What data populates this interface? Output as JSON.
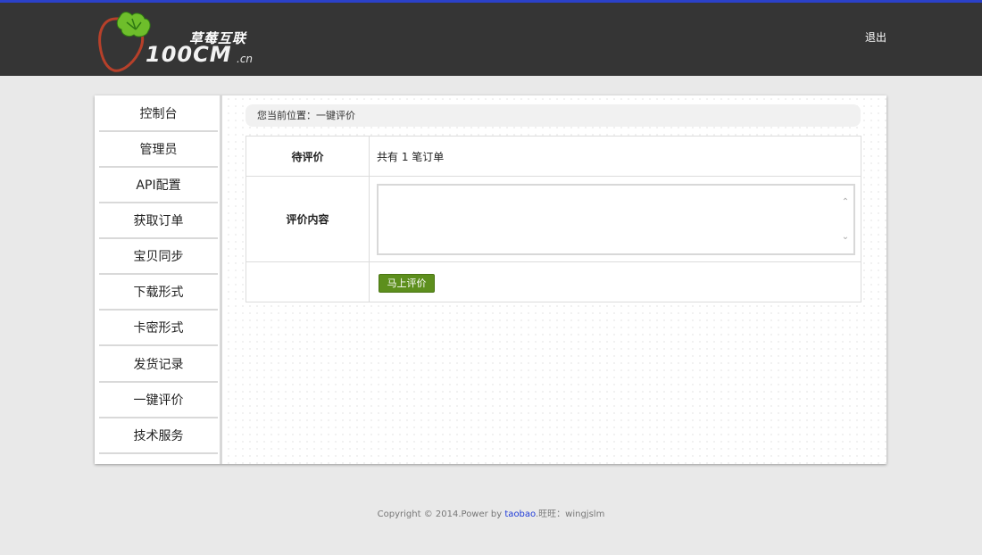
{
  "header": {
    "logo_cn": "草莓互联",
    "logo_main": "100CM",
    "logo_suffix": ".cn",
    "logout_label": "退出"
  },
  "sidebar": {
    "items": [
      {
        "label": "控制台"
      },
      {
        "label": "管理员"
      },
      {
        "label": "API配置"
      },
      {
        "label": "获取订单"
      },
      {
        "label": "宝贝同步"
      },
      {
        "label": "下载形式"
      },
      {
        "label": "卡密形式"
      },
      {
        "label": "发货记录"
      },
      {
        "label": "一键评价"
      },
      {
        "label": "技术服务"
      }
    ]
  },
  "main": {
    "breadcrumb": "您当前位置：一键评价",
    "form": {
      "pending_label": "待评价",
      "pending_value": "共有 1 笔订单",
      "content_label": "评价内容",
      "content_value": "",
      "submit_label": "马上评价"
    }
  },
  "footer": {
    "copyright": "Copyright © 2014.Power by ",
    "link_label": "taobao",
    "contact": ".旺旺：wingjslm"
  },
  "colors": {
    "header_bg": "#353535",
    "top_line": "#2b41c9",
    "button_green": "#5d8f1d",
    "link_blue": "#1f3bd8"
  }
}
